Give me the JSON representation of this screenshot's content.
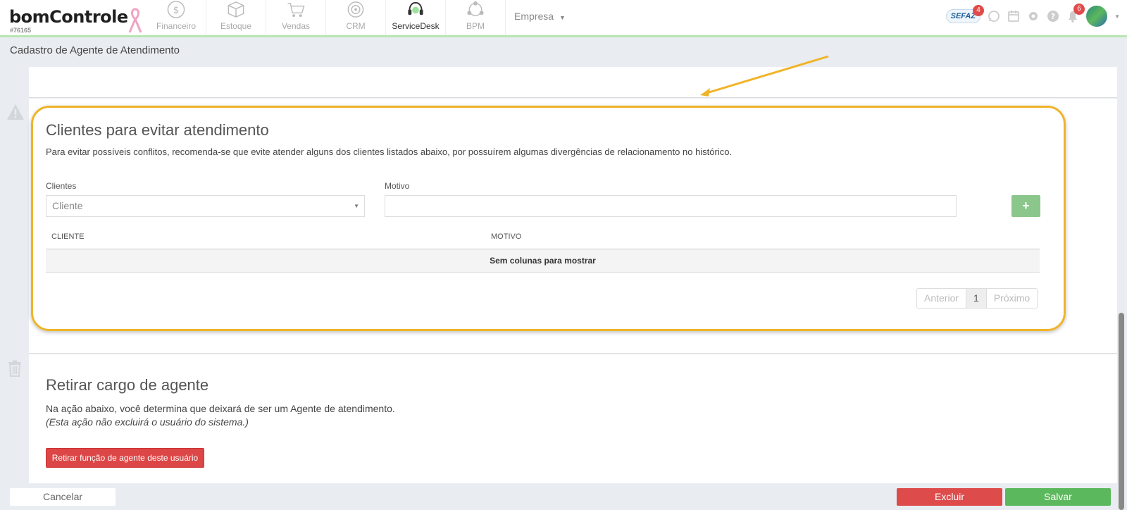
{
  "header": {
    "logo": "bomControle",
    "account_code": "#76165",
    "modules": [
      {
        "label": "Financeiro",
        "icon": "dollar-icon"
      },
      {
        "label": "Estoque",
        "icon": "box-icon"
      },
      {
        "label": "Vendas",
        "icon": "cart-icon"
      },
      {
        "label": "CRM",
        "icon": "target-icon"
      },
      {
        "label": "ServiceDesk",
        "icon": "headset-icon"
      },
      {
        "label": "BPM",
        "icon": "network-icon"
      }
    ],
    "empresa": "Empresa",
    "sefaz_label": "SEFAZ",
    "sefaz_badge": "4",
    "notifications_badge": "6"
  },
  "page": {
    "title": "Cadastro de Agente de Atendimento"
  },
  "clients_section": {
    "title": "Clientes para evitar atendimento",
    "description": "Para evitar possíveis conflitos, recomenda-se que evite atender alguns dos clientes listados abaixo, por possuírem algumas divergências de relacionamento no histórico.",
    "clients_label": "Clientes",
    "clients_placeholder": "Cliente",
    "reason_label": "Motivo",
    "reason_value": "",
    "add_label": "+",
    "columns": [
      "CLIENTE",
      "MOTIVO"
    ],
    "empty_text": "Sem colunas para mostrar",
    "pager": {
      "prev": "Anterior",
      "current": "1",
      "next": "Próximo"
    }
  },
  "remove_section": {
    "title": "Retirar cargo de agente",
    "description": "Na ação abaixo, você determina que deixará de ser um Agente de atendimento.",
    "note": "(Esta ação não excluirá o usuário do sistema.)",
    "button": "Retirar função de agente deste usuário"
  },
  "footer": {
    "cancel": "Cancelar",
    "delete": "Excluir",
    "save": "Salvar"
  },
  "colors": {
    "highlight": "#f0b429",
    "success": "#5cb85c",
    "danger": "#dd4b4b"
  }
}
